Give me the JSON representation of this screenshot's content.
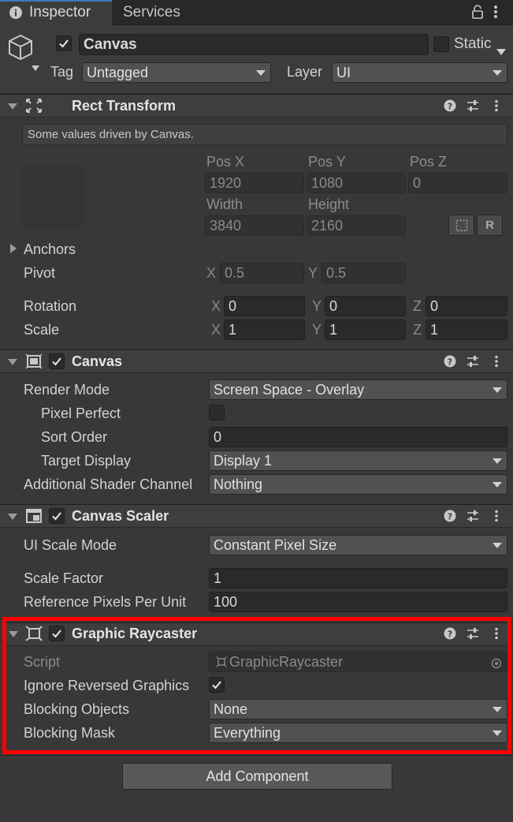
{
  "tabs": [
    {
      "label": "Inspector",
      "active": true,
      "icon": "info-icon"
    },
    {
      "label": "Services",
      "active": false
    }
  ],
  "tab_actions": [
    "lock-icon",
    "kebab-menu-icon"
  ],
  "object": {
    "enabled": true,
    "name": "Canvas",
    "static_label": "Static",
    "static_checked": false,
    "tag_label": "Tag",
    "tag_value": "Untagged",
    "layer_label": "Layer",
    "layer_value": "UI"
  },
  "rect_transform": {
    "title": "Rect Transform",
    "info": "Some values driven by Canvas.",
    "pos_x_label": "Pos X",
    "pos_y_label": "Pos Y",
    "pos_z_label": "Pos Z",
    "pos_x": "1920",
    "pos_y": "1080",
    "pos_z": "0",
    "width_label": "Width",
    "height_label": "Height",
    "width": "3840",
    "height": "2160",
    "raw_label": "R",
    "anchors_label": "Anchors",
    "pivot_label": "Pivot",
    "pivot_x": "0.5",
    "pivot_y": "0.5",
    "rotation_label": "Rotation",
    "rot_x": "0",
    "rot_y": "0",
    "rot_z": "0",
    "scale_label": "Scale",
    "scale_x": "1",
    "scale_y": "1",
    "scale_z": "1",
    "axis_x": "X",
    "axis_y": "Y",
    "axis_z": "Z"
  },
  "canvas": {
    "title": "Canvas",
    "enabled": true,
    "render_mode_label": "Render Mode",
    "render_mode": "Screen Space - Overlay",
    "pixel_perfect_label": "Pixel Perfect",
    "pixel_perfect": false,
    "sort_order_label": "Sort Order",
    "sort_order": "0",
    "target_display_label": "Target Display",
    "target_display": "Display 1",
    "shader_channels_label": "Additional Shader Channel",
    "shader_channels": "Nothing"
  },
  "canvas_scaler": {
    "title": "Canvas Scaler",
    "enabled": true,
    "ui_scale_mode_label": "UI Scale Mode",
    "ui_scale_mode": "Constant Pixel Size",
    "scale_factor_label": "Scale Factor",
    "scale_factor": "1",
    "ref_ppu_label": "Reference Pixels Per Unit",
    "ref_ppu": "100"
  },
  "graphic_raycaster": {
    "title": "Graphic Raycaster",
    "enabled": true,
    "script_label": "Script",
    "script_value": "GraphicRaycaster",
    "ignore_reversed_label": "Ignore Reversed Graphics",
    "ignore_reversed": true,
    "blocking_objects_label": "Blocking Objects",
    "blocking_objects": "None",
    "blocking_mask_label": "Blocking Mask",
    "blocking_mask": "Everything"
  },
  "add_component_label": "Add Component",
  "colors": {
    "highlight": "#ff0000",
    "background": "#383838",
    "tab_accent": "#3a79bb"
  }
}
